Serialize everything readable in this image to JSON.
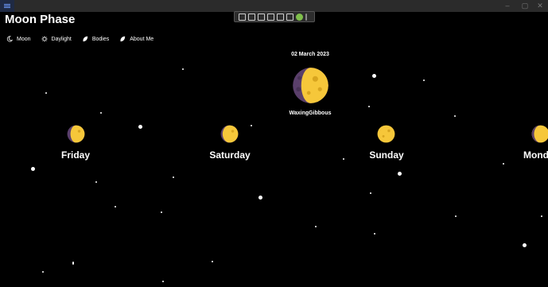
{
  "window": {
    "minimize_glyph": "–",
    "maximize_glyph": "▢",
    "close_glyph": "✕"
  },
  "dev_toolbar": {
    "buttons": [
      "select-element-icon",
      "video-icon",
      "comment-icon",
      "layout-icon",
      "track-focus-icon",
      "binding-icon",
      "ok-indicator-icon"
    ]
  },
  "app": {
    "title": "Moon Phase"
  },
  "nav": {
    "items": [
      {
        "label": "Moon",
        "icon": "moon-icon"
      },
      {
        "label": "Daylight",
        "icon": "sun-icon"
      },
      {
        "label": "Bodies",
        "icon": "planet-icon"
      },
      {
        "label": "About Me",
        "icon": "info-icon"
      }
    ]
  },
  "today": {
    "date": "02 March 2023",
    "phase": "WaxingGibbous"
  },
  "forecast": {
    "days": [
      {
        "name": "Friday"
      },
      {
        "name": "Saturday"
      },
      {
        "name": "Sunday"
      },
      {
        "name": "Mond"
      }
    ]
  },
  "colors": {
    "moon_lit": "#f6c73a",
    "moon_dark": "#5a3f6b",
    "crater": "#d8a51f",
    "background": "#000000"
  }
}
